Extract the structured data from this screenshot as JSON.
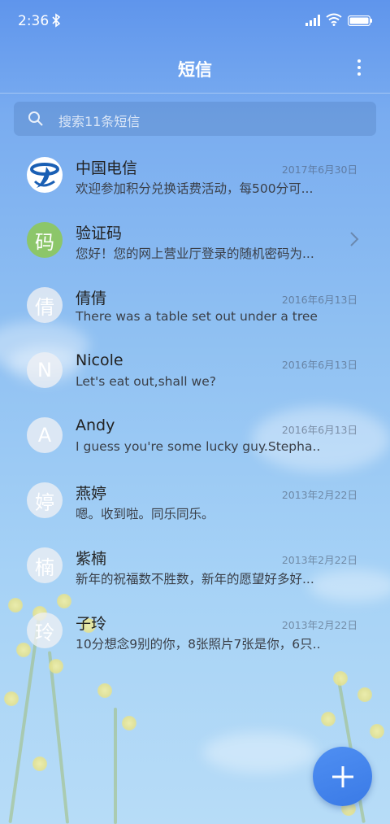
{
  "status": {
    "time": "2:36"
  },
  "header": {
    "title": "短信"
  },
  "search": {
    "placeholder": "搜索11条短信"
  },
  "messages": [
    {
      "avatar": "",
      "name": "中国电信",
      "date": "2017年6月30日",
      "preview": "欢迎参加积分兑换话费活动，每500分可..."
    },
    {
      "avatar": "码",
      "name": "验证码",
      "date": "",
      "preview": "您好！您的网上营业厅登录的随机密码为..."
    },
    {
      "avatar": "倩",
      "name": "倩倩",
      "date": "2016年6月13日",
      "preview": "There was a table set out under a tree i..."
    },
    {
      "avatar": "N",
      "name": "Nicole",
      "date": "2016年6月13日",
      "preview": "Let's eat out,shall we?"
    },
    {
      "avatar": "A",
      "name": "Andy",
      "date": "2016年6月13日",
      "preview": "I guess you're some lucky guy.Stepha..."
    },
    {
      "avatar": "婷",
      "name": "燕婷",
      "date": "2013年2月22日",
      "preview": "嗯。收到啦。同乐同乐。"
    },
    {
      "avatar": "楠",
      "name": "紫楠",
      "date": "2013年2月22日",
      "preview": "新年的祝福数不胜数，新年的愿望好多好..."
    },
    {
      "avatar": "玲",
      "name": "子玲",
      "date": "2013年2月22日",
      "preview": "10分想念9别的你，8张照片7张是你，6只..."
    }
  ],
  "colors": {
    "accent": "#3f80ea",
    "verification_avatar": "#8cc66a",
    "telecom_logo": "#1a5fb4"
  }
}
